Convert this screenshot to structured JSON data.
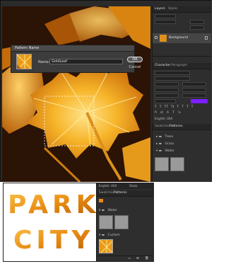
{
  "top": {
    "layers_tabs": [
      "Layers",
      "Styles"
    ],
    "layer_name": "Background",
    "character_tabs": [
      "Character",
      "Paragraph"
    ],
    "character": {
      "lang": "English: USA"
    },
    "swatches_tabs": [
      "Swatches",
      "Patterns"
    ],
    "pattern_folders": [
      "Trees",
      "Grass",
      "Water"
    ]
  },
  "dialog": {
    "title": "Pattern Name",
    "name_label": "Name:",
    "name_value": "GoldLeaf",
    "ok_label": "OK",
    "cancel_label": "Cancel"
  },
  "bottom": {
    "headline_line1": "PARK",
    "headline_line2": "CITY",
    "lang": "English: USA",
    "antialias": "Sharp",
    "tabs": [
      "Swatches",
      "Patterns"
    ],
    "folders": [
      "Water",
      "Custom"
    ]
  },
  "colors": {
    "accent_purple": "#7b1fff",
    "leaf_gold": "#f4a21a",
    "dark_bg": "#2e2e2e"
  }
}
